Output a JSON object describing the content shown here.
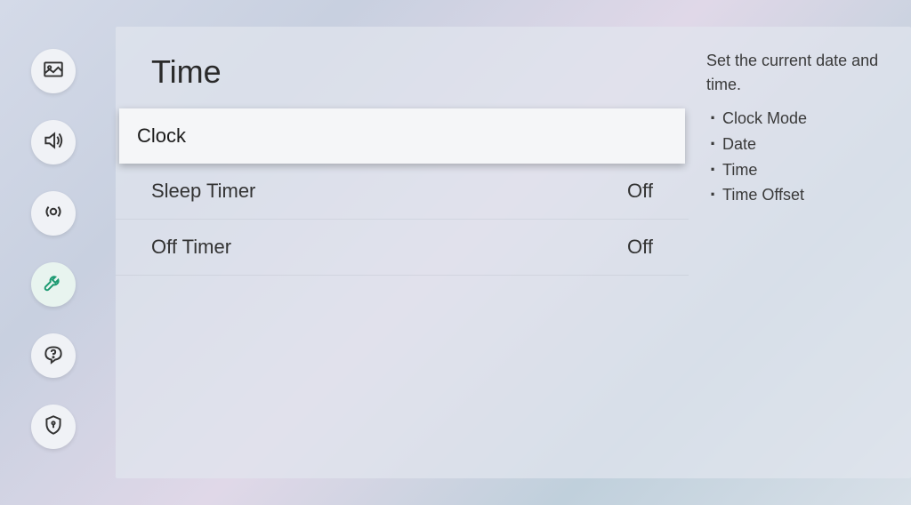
{
  "page": {
    "title": "Time"
  },
  "menu": {
    "items": [
      {
        "label": "Clock",
        "value": "",
        "selected": true
      },
      {
        "label": "Sleep Timer",
        "value": "Off",
        "selected": false
      },
      {
        "label": "Off Timer",
        "value": "Off",
        "selected": false
      }
    ]
  },
  "description": {
    "text": "Set the current date and time.",
    "bullets": [
      "Clock Mode",
      "Date",
      "Time",
      "Time Offset"
    ]
  },
  "sidebar": {
    "items": [
      {
        "name": "picture"
      },
      {
        "name": "sound"
      },
      {
        "name": "broadcasting"
      },
      {
        "name": "general",
        "active": true
      },
      {
        "name": "support"
      },
      {
        "name": "privacy"
      }
    ]
  }
}
